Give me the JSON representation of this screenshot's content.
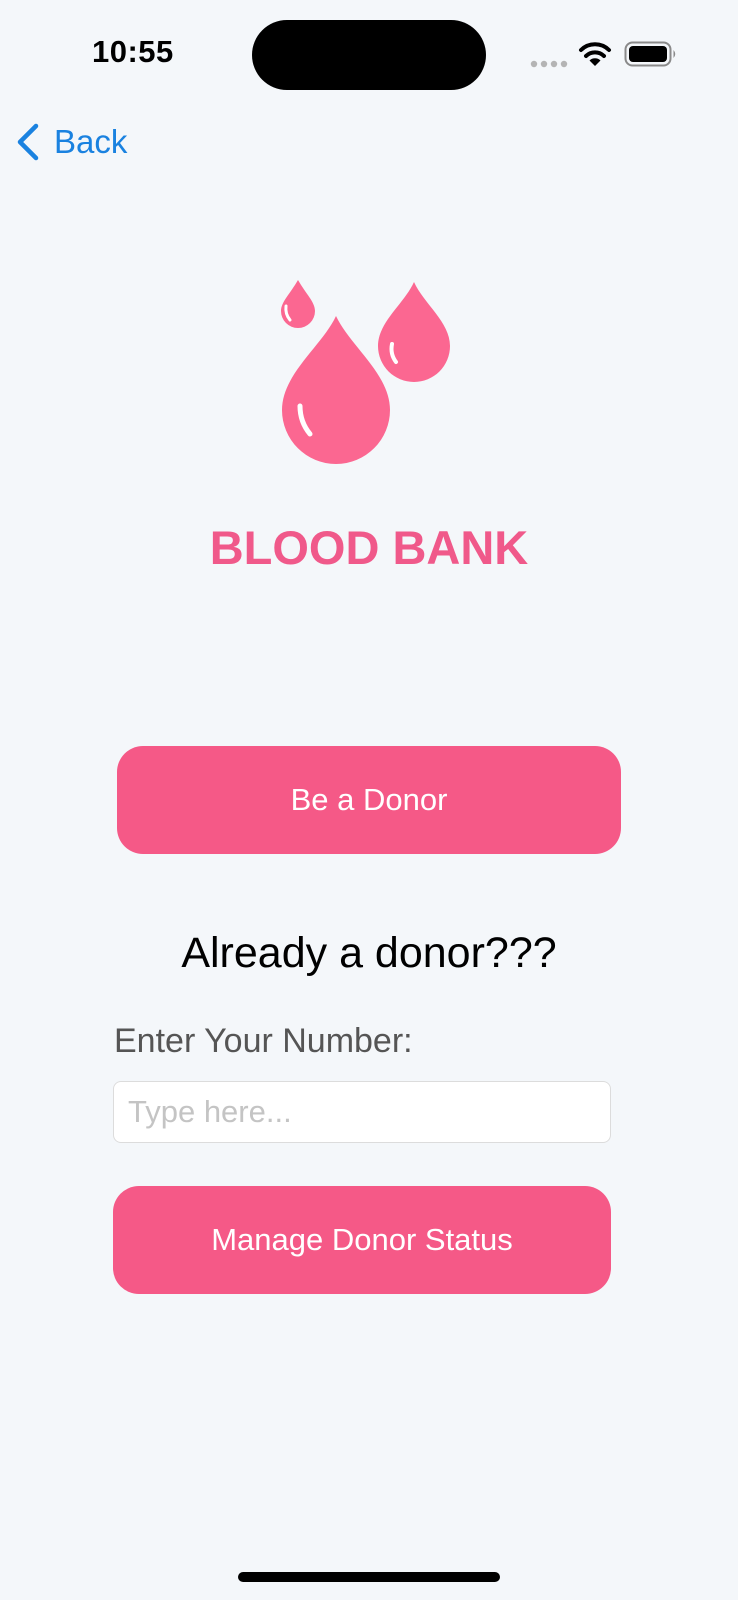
{
  "status_bar": {
    "time": "10:55",
    "icons": [
      "signal-icon",
      "wifi-icon",
      "battery-icon"
    ]
  },
  "nav": {
    "back_label": "Back"
  },
  "brand": {
    "logo_icon": "blood-drops-icon",
    "title": "BLOOD BANK"
  },
  "actions": {
    "be_donor_label": "Be a Donor",
    "already_donor_heading": "Already a donor???",
    "number_label": "Enter Your Number:",
    "number_input": {
      "value": "",
      "placeholder": "Type here..."
    },
    "manage_label": "Manage Donor Status"
  },
  "colors": {
    "accent_pink": "#f55987",
    "title_pink": "#f0598a",
    "drop_pink": "#fb6791",
    "link_blue": "#1a82e0",
    "background": "#f4f7fa"
  }
}
